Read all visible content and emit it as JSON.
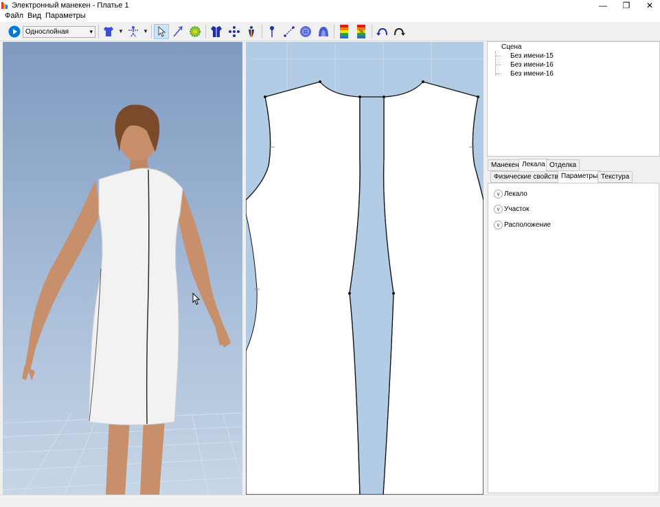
{
  "window": {
    "title": "Электронный манекен - Платье 1",
    "controls": {
      "minimize": "—",
      "restore": "❐",
      "close": "✕"
    }
  },
  "menu": [
    "Файл",
    "Вид",
    "Параметры"
  ],
  "toolbar": {
    "mode_select": "Однослойная",
    "icons": [
      "play-icon",
      "shirt-icon",
      "figure-icon",
      "pointer-icon",
      "pen-icon",
      "gear-flower-icon",
      "garment-icon",
      "points-icon",
      "mannequin-icon",
      "pin-icon",
      "measure-icon",
      "button-icon",
      "hood-icon",
      "tension-map-icon",
      "percent-map-icon",
      "undo-icon",
      "redo-icon"
    ]
  },
  "scene_tree": {
    "root": "Сцена",
    "items": [
      "Без имени-15",
      "Без имени-16",
      "Без имени-16"
    ]
  },
  "properties": {
    "main_tabs": [
      "Манекен",
      "Лекала",
      "Отделка"
    ],
    "main_tab_selected": "Лекала",
    "sub_tabs": [
      "Физические свойства",
      "Параметры",
      "Текстура"
    ],
    "sub_tab_selected": "Параметры",
    "sections": [
      "Лекало",
      "Участок",
      "Расположение"
    ]
  },
  "colors": {
    "pattern_bg": "#b3cce6",
    "accent": "#0078d7",
    "dress": "#f2f2f2"
  }
}
